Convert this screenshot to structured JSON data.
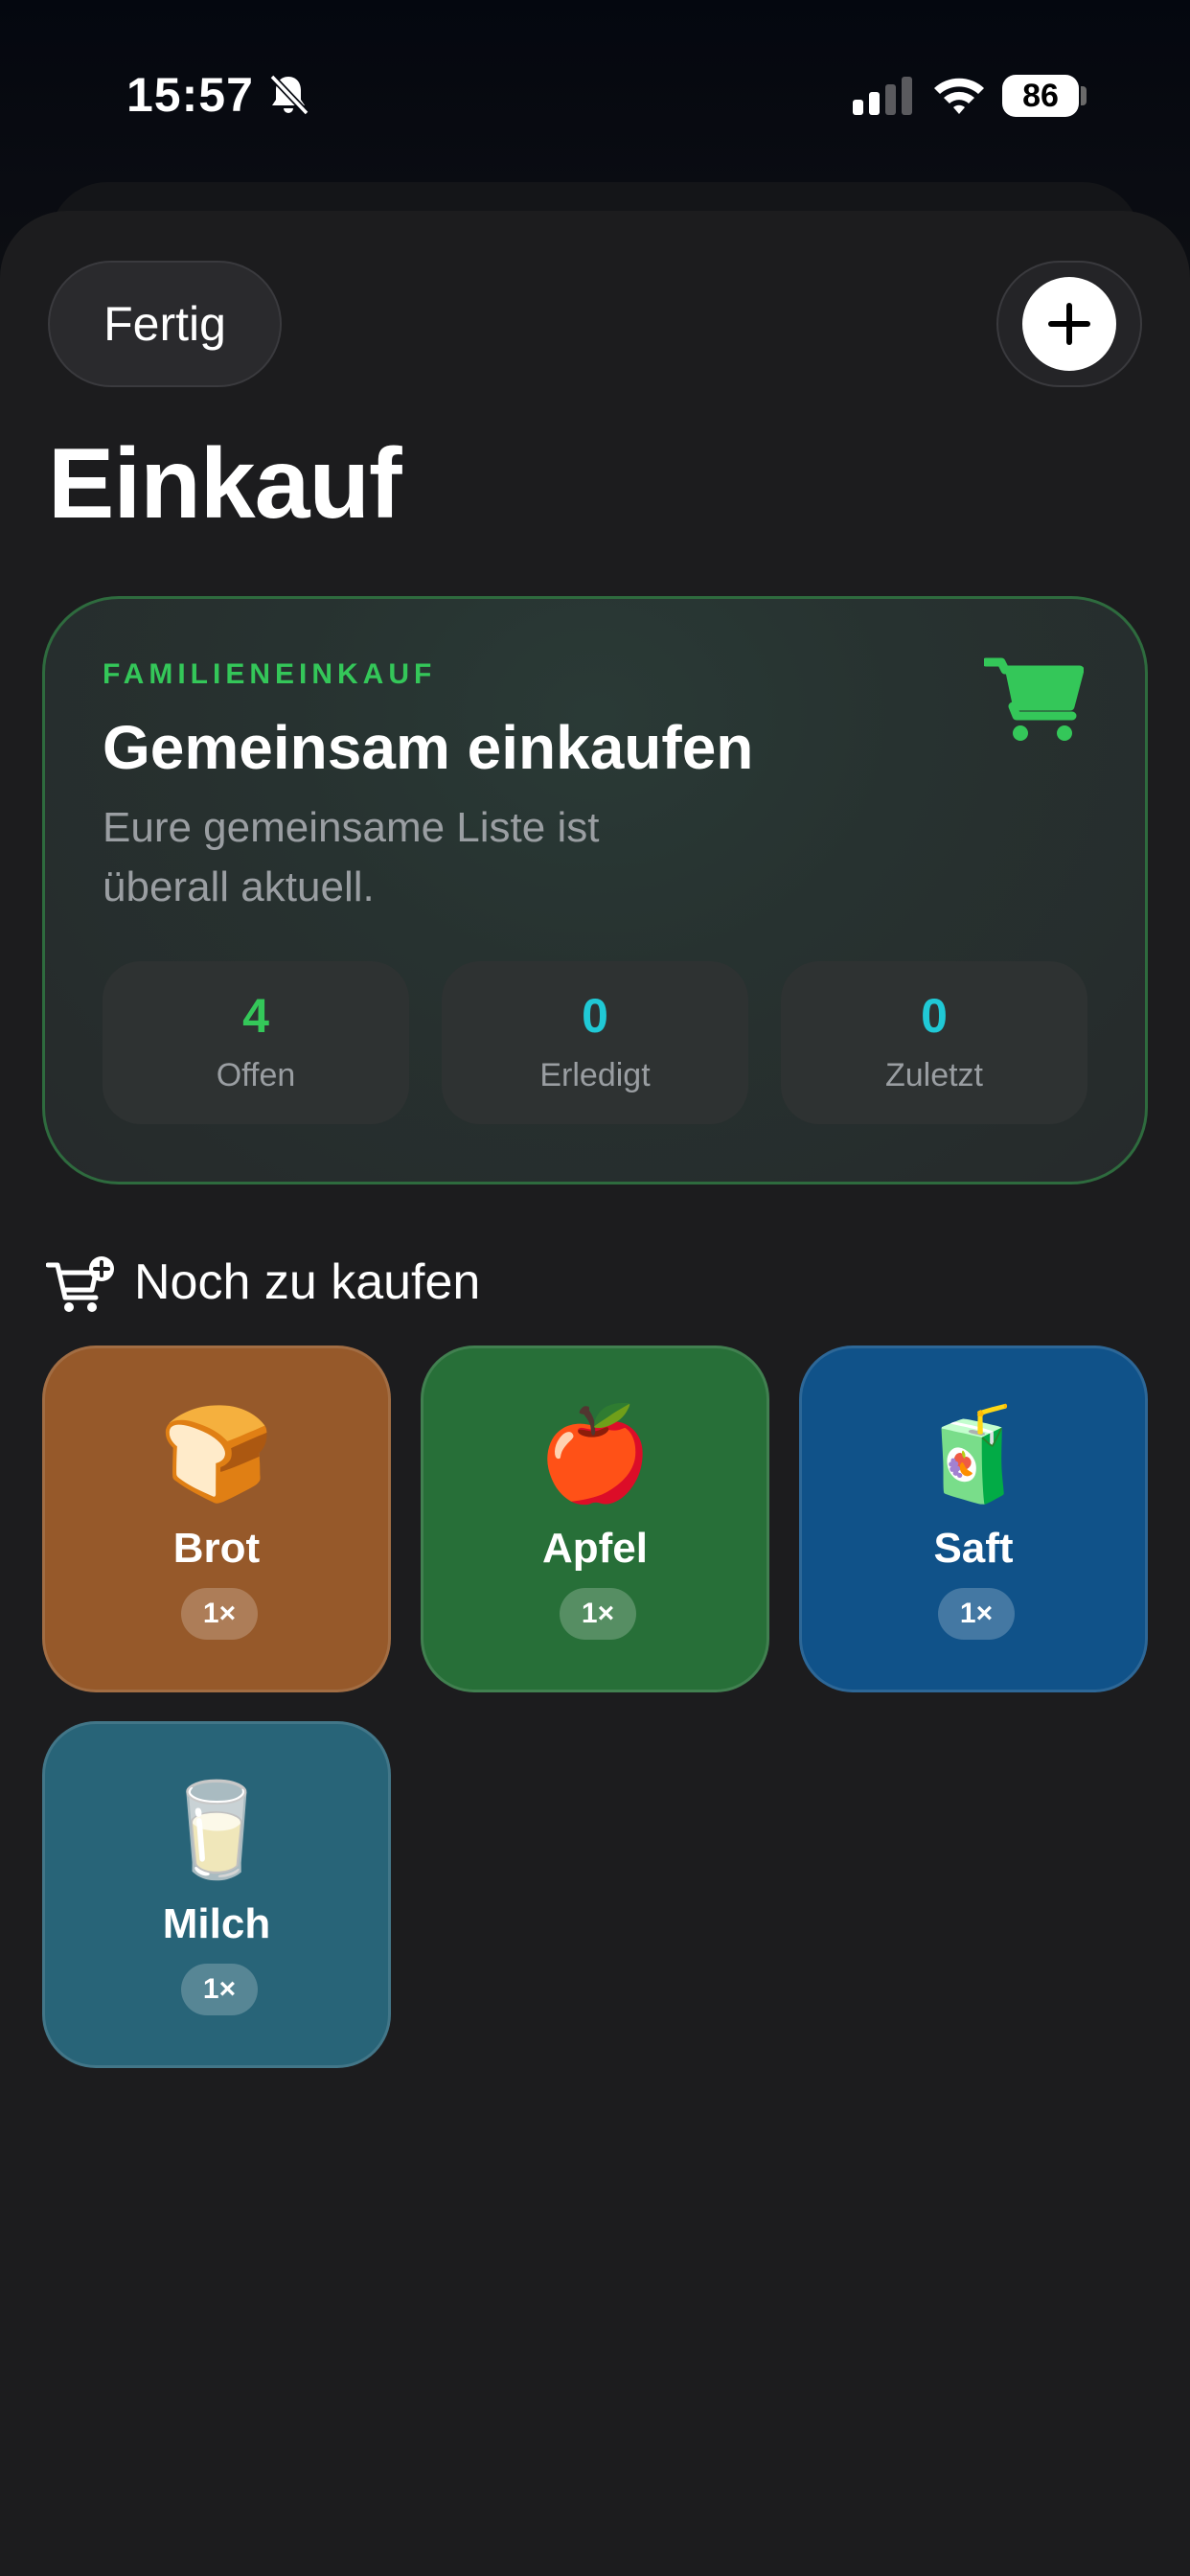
{
  "status_bar": {
    "time": "15:57",
    "battery": "86",
    "icons": [
      "bell-slash-icon",
      "cellular-signal-icon",
      "wifi-icon",
      "battery-icon"
    ]
  },
  "header": {
    "done_label": "Fertig",
    "add_icon": "plus-icon",
    "title": "Einkauf"
  },
  "hero": {
    "eyebrow": "FAMILIENEINKAUF",
    "title": "Gemeinsam einkaufen",
    "subtitle": "Eure gemeinsame Liste ist überall aktuell.",
    "icon": "cart-icon",
    "stats": [
      {
        "value": "4",
        "label": "Offen",
        "color": "#34c759"
      },
      {
        "value": "0",
        "label": "Erledigt",
        "color": "#20c9d6"
      },
      {
        "value": "0",
        "label": "Zuletzt",
        "color": "#20c9d6"
      }
    ]
  },
  "section": {
    "icon": "cart-badge-plus-icon",
    "title": "Noch zu kaufen"
  },
  "items": [
    {
      "emoji": "🍞",
      "name": "Brot",
      "qty": "1×",
      "color": "#96592a"
    },
    {
      "emoji": "🍎",
      "name": "Apfel",
      "qty": "1×",
      "color": "#276f38"
    },
    {
      "emoji": "🧃",
      "name": "Saft",
      "qty": "1×",
      "color": "#105289"
    },
    {
      "emoji": "🥛",
      "name": "Milch",
      "qty": "1×",
      "color": "#286478"
    }
  ],
  "colors": {
    "accent_green": "#34c759",
    "accent_teal": "#20c9d6",
    "sheet_background": "#1c1c1e"
  }
}
